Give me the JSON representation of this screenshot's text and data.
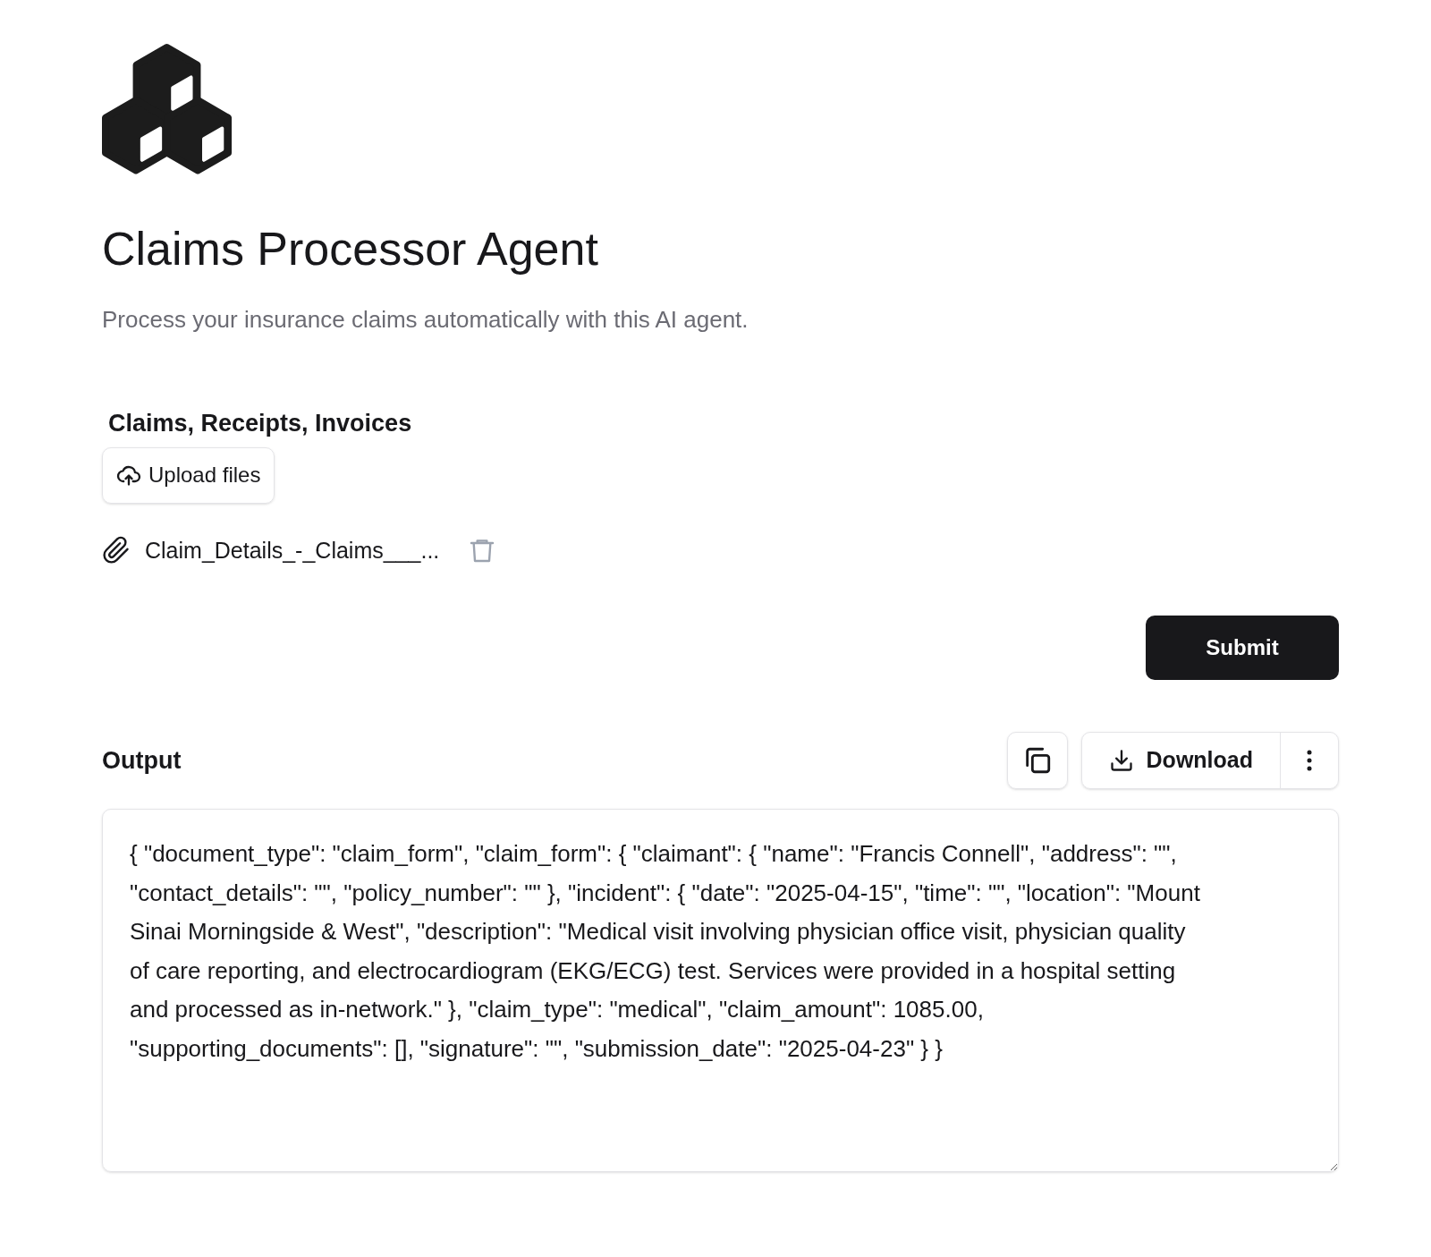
{
  "title": "Claims Processor Agent",
  "subtitle": "Process your insurance claims automatically with this AI agent.",
  "upload": {
    "label": "Claims, Receipts, Invoices",
    "button": "Upload files"
  },
  "files": [
    {
      "name": "Claim_Details_-_Claims___..."
    }
  ],
  "submit": "Submit",
  "output": {
    "label": "Output",
    "download": "Download",
    "value": "{ \"document_type\": \"claim_form\", \"claim_form\": { \"claimant\": { \"name\": \"Francis Connell\", \"address\": \"\", \"contact_details\": \"\", \"policy_number\": \"\" }, \"incident\": { \"date\": \"2025-04-15\", \"time\": \"\", \"location\": \"Mount Sinai Morningside & West\", \"description\": \"Medical visit involving physician office visit, physician quality of care reporting, and electrocardiogram (EKG/ECG) test. Services were provided in a hospital setting and processed as in-network.\" }, \"claim_type\": \"medical\", \"claim_amount\": 1085.00, \"supporting_documents\": [], \"signature\": \"\", \"submission_date\": \"2025-04-23\" } }"
  }
}
